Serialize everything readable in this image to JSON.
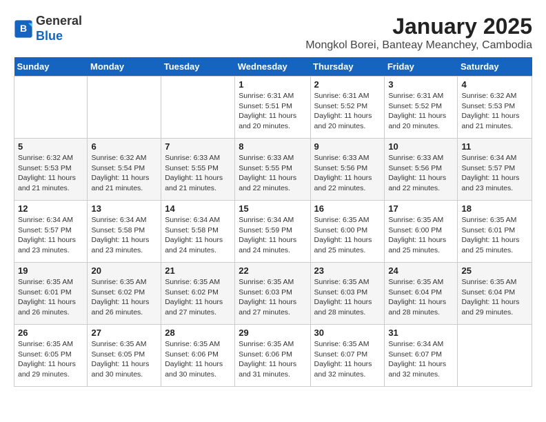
{
  "logo": {
    "general": "General",
    "blue": "Blue"
  },
  "title": "January 2025",
  "subtitle": "Mongkol Borei, Banteay Meanchey, Cambodia",
  "headers": [
    "Sunday",
    "Monday",
    "Tuesday",
    "Wednesday",
    "Thursday",
    "Friday",
    "Saturday"
  ],
  "weeks": [
    [
      {
        "day": "",
        "info": ""
      },
      {
        "day": "",
        "info": ""
      },
      {
        "day": "",
        "info": ""
      },
      {
        "day": "1",
        "info": "Sunrise: 6:31 AM\nSunset: 5:51 PM\nDaylight: 11 hours and 20 minutes."
      },
      {
        "day": "2",
        "info": "Sunrise: 6:31 AM\nSunset: 5:52 PM\nDaylight: 11 hours and 20 minutes."
      },
      {
        "day": "3",
        "info": "Sunrise: 6:31 AM\nSunset: 5:52 PM\nDaylight: 11 hours and 20 minutes."
      },
      {
        "day": "4",
        "info": "Sunrise: 6:32 AM\nSunset: 5:53 PM\nDaylight: 11 hours and 21 minutes."
      }
    ],
    [
      {
        "day": "5",
        "info": "Sunrise: 6:32 AM\nSunset: 5:53 PM\nDaylight: 11 hours and 21 minutes."
      },
      {
        "day": "6",
        "info": "Sunrise: 6:32 AM\nSunset: 5:54 PM\nDaylight: 11 hours and 21 minutes."
      },
      {
        "day": "7",
        "info": "Sunrise: 6:33 AM\nSunset: 5:55 PM\nDaylight: 11 hours and 21 minutes."
      },
      {
        "day": "8",
        "info": "Sunrise: 6:33 AM\nSunset: 5:55 PM\nDaylight: 11 hours and 22 minutes."
      },
      {
        "day": "9",
        "info": "Sunrise: 6:33 AM\nSunset: 5:56 PM\nDaylight: 11 hours and 22 minutes."
      },
      {
        "day": "10",
        "info": "Sunrise: 6:33 AM\nSunset: 5:56 PM\nDaylight: 11 hours and 22 minutes."
      },
      {
        "day": "11",
        "info": "Sunrise: 6:34 AM\nSunset: 5:57 PM\nDaylight: 11 hours and 23 minutes."
      }
    ],
    [
      {
        "day": "12",
        "info": "Sunrise: 6:34 AM\nSunset: 5:57 PM\nDaylight: 11 hours and 23 minutes."
      },
      {
        "day": "13",
        "info": "Sunrise: 6:34 AM\nSunset: 5:58 PM\nDaylight: 11 hours and 23 minutes."
      },
      {
        "day": "14",
        "info": "Sunrise: 6:34 AM\nSunset: 5:58 PM\nDaylight: 11 hours and 24 minutes."
      },
      {
        "day": "15",
        "info": "Sunrise: 6:34 AM\nSunset: 5:59 PM\nDaylight: 11 hours and 24 minutes."
      },
      {
        "day": "16",
        "info": "Sunrise: 6:35 AM\nSunset: 6:00 PM\nDaylight: 11 hours and 25 minutes."
      },
      {
        "day": "17",
        "info": "Sunrise: 6:35 AM\nSunset: 6:00 PM\nDaylight: 11 hours and 25 minutes."
      },
      {
        "day": "18",
        "info": "Sunrise: 6:35 AM\nSunset: 6:01 PM\nDaylight: 11 hours and 25 minutes."
      }
    ],
    [
      {
        "day": "19",
        "info": "Sunrise: 6:35 AM\nSunset: 6:01 PM\nDaylight: 11 hours and 26 minutes."
      },
      {
        "day": "20",
        "info": "Sunrise: 6:35 AM\nSunset: 6:02 PM\nDaylight: 11 hours and 26 minutes."
      },
      {
        "day": "21",
        "info": "Sunrise: 6:35 AM\nSunset: 6:02 PM\nDaylight: 11 hours and 27 minutes."
      },
      {
        "day": "22",
        "info": "Sunrise: 6:35 AM\nSunset: 6:03 PM\nDaylight: 11 hours and 27 minutes."
      },
      {
        "day": "23",
        "info": "Sunrise: 6:35 AM\nSunset: 6:03 PM\nDaylight: 11 hours and 28 minutes."
      },
      {
        "day": "24",
        "info": "Sunrise: 6:35 AM\nSunset: 6:04 PM\nDaylight: 11 hours and 28 minutes."
      },
      {
        "day": "25",
        "info": "Sunrise: 6:35 AM\nSunset: 6:04 PM\nDaylight: 11 hours and 29 minutes."
      }
    ],
    [
      {
        "day": "26",
        "info": "Sunrise: 6:35 AM\nSunset: 6:05 PM\nDaylight: 11 hours and 29 minutes."
      },
      {
        "day": "27",
        "info": "Sunrise: 6:35 AM\nSunset: 6:05 PM\nDaylight: 11 hours and 30 minutes."
      },
      {
        "day": "28",
        "info": "Sunrise: 6:35 AM\nSunset: 6:06 PM\nDaylight: 11 hours and 30 minutes."
      },
      {
        "day": "29",
        "info": "Sunrise: 6:35 AM\nSunset: 6:06 PM\nDaylight: 11 hours and 31 minutes."
      },
      {
        "day": "30",
        "info": "Sunrise: 6:35 AM\nSunset: 6:07 PM\nDaylight: 11 hours and 32 minutes."
      },
      {
        "day": "31",
        "info": "Sunrise: 6:34 AM\nSunset: 6:07 PM\nDaylight: 11 hours and 32 minutes."
      },
      {
        "day": "",
        "info": ""
      }
    ]
  ]
}
